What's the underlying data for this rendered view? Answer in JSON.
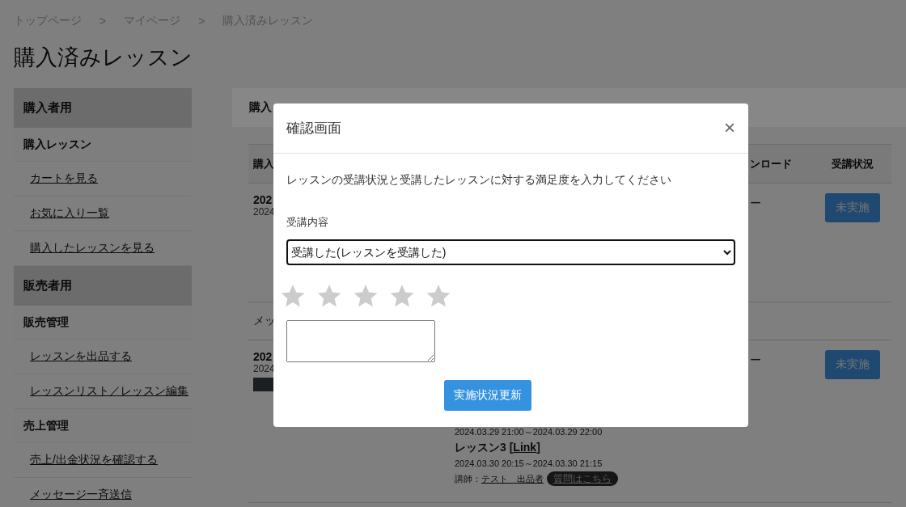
{
  "breadcrumb": {
    "items": [
      "トップページ",
      "マイページ",
      "購入済みレッスン"
    ],
    "separators": [
      ">",
      ">"
    ]
  },
  "page_title": "購入済みレッスン",
  "sidebar": {
    "sections": [
      {
        "title": "購入者用",
        "groups": [
          {
            "title": "購入レッスン",
            "links": [
              "カートを見る",
              "お気に入り一覧",
              "購入したレッスンを見る"
            ]
          }
        ]
      },
      {
        "title": "販売者用",
        "groups": [
          {
            "title": "販売管理",
            "links": [
              "レッスンを出品する",
              "レッスンリスト／レッスン編集"
            ]
          },
          {
            "title": "売上管理",
            "links": [
              "売上/出金状況を確認する",
              "メッセージ一斉送信"
            ]
          }
        ]
      }
    ]
  },
  "main": {
    "panel_title": "購入",
    "table": {
      "columns": [
        "購入",
        "ンロード",
        "受講状況"
      ],
      "rows": [
        {
          "kind": "lesson",
          "date_bold": "202",
          "date": "2024",
          "bar": false,
          "download": "ー",
          "status": "未実施"
        },
        {
          "kind": "message",
          "text": "メッ"
        },
        {
          "kind": "lesson",
          "date_bold": "202",
          "date": "2024",
          "bar": true,
          "download": "ー",
          "status": "未実施",
          "lessons": [
            {
              "time": "2024.03.29 21:00～2024.03.29 22:00"
            },
            {
              "title_prefix": "レッスン3 [",
              "link": "Link",
              "title_suffix": "]",
              "time": "2024.03.30 20:15～2024.03.30 21:15",
              "teacher_label": "講師：",
              "teacher": "テスト　出品者",
              "question": "質問はこちら"
            }
          ]
        }
      ]
    }
  },
  "modal": {
    "title": "確認画面",
    "close": "×",
    "instruction": "レッスンの受講状況と受講したレッスンに対する満足度を入力してください",
    "field_label": "受講内容",
    "select_value": "受講した(レッスンを受講した)",
    "stars": 0,
    "submit": "実施状況更新"
  }
}
